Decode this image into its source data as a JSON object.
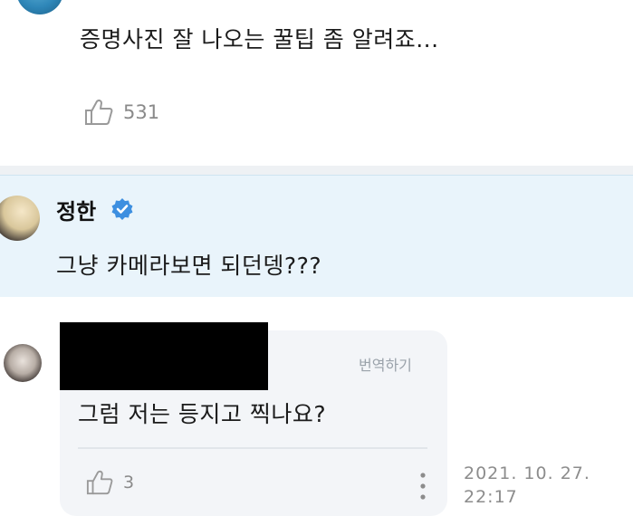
{
  "top_comment": {
    "text": "증명사진 잘 나오는 꿀팁 좀 알려죠...",
    "like_count": "531"
  },
  "artist_reply": {
    "name": "정한",
    "text": "그냥 카메라보면 되던뎅???",
    "verified": true
  },
  "fan_reply": {
    "translate_label": "번역하기",
    "text": "그럼 저는 등지고 찍나요?",
    "like_count": "3",
    "timestamp_line1": "2021. 10. 27.",
    "timestamp_line2": "22:17"
  },
  "icons": {
    "like": "thumbs-up-icon",
    "verified": "verified-badge-icon",
    "more": "more-vertical-icon"
  },
  "colors": {
    "highlight_bg": "#e9f4fb",
    "verified_blue": "#3d8fe0",
    "bubble_bg": "#f3f5f8"
  }
}
